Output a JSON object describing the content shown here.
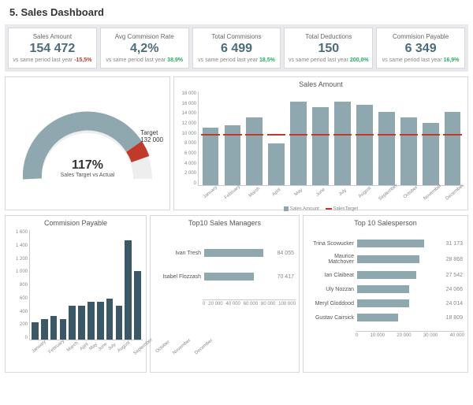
{
  "page_title": "5. Sales Dashboard",
  "kpis": [
    {
      "title": "Sales Amount",
      "value": "154 472",
      "sub": "vs same period last year",
      "pct": "-15,5%",
      "dir": "neg"
    },
    {
      "title": "Avg Commision Rate",
      "value": "4,2%",
      "sub": "vs same period last year",
      "pct": "38,9%",
      "dir": "pos"
    },
    {
      "title": "Total Commisions",
      "value": "6 499",
      "sub": "vs same period last year",
      "pct": "18,5%",
      "dir": "pos"
    },
    {
      "title": "Total Deductions",
      "value": "150",
      "sub": "vs same period last year",
      "pct": "200,0%",
      "dir": "pos"
    },
    {
      "title": "Commision Payable",
      "value": "6 349",
      "sub": "vs same period last year",
      "pct": "16,9%",
      "dir": "pos"
    }
  ],
  "gauge": {
    "target_label": "Target",
    "target_value": "132 000",
    "pct": "117%",
    "sub": "Sales Target vs Actual"
  },
  "sales_chart": {
    "title": "Sales Amount",
    "legend_a": "Sales Amount",
    "legend_b": "SalesTarget"
  },
  "commission_title": "Commision Payable",
  "managers_title": "Top10 Sales Managers",
  "salesperson_title": "Top 10 Salesperson",
  "chart_data": {
    "sales_amount": {
      "type": "bar",
      "title": "Sales Amount",
      "categories": [
        "January",
        "February",
        "March",
        "April",
        "May",
        "June",
        "July",
        "August",
        "September",
        "October",
        "November",
        "December"
      ],
      "series": [
        {
          "name": "Sales Amount",
          "values": [
            11000,
            11500,
            13000,
            8000,
            16000,
            15000,
            16000,
            15500,
            14000,
            13000,
            12000,
            14000
          ]
        },
        {
          "name": "SalesTarget",
          "values": [
            9500,
            9500,
            9500,
            9500,
            9500,
            9500,
            9500,
            9500,
            9500,
            9500,
            9500,
            9500
          ]
        }
      ],
      "ylim": [
        0,
        18000
      ],
      "yticks": [
        0,
        2000,
        4000,
        6000,
        8000,
        10000,
        12000,
        14000,
        16000,
        18000
      ]
    },
    "gauge": {
      "type": "gauge",
      "title": "Sales Target vs Actual",
      "value_pct": 117,
      "target": 132000
    },
    "commission_payable": {
      "type": "bar",
      "title": "Commision Payable",
      "categories": [
        "January",
        "February",
        "March",
        "April",
        "May",
        "June",
        "July",
        "August",
        "September",
        "October",
        "November",
        "December"
      ],
      "values": [
        250,
        300,
        350,
        300,
        500,
        500,
        550,
        550,
        600,
        500,
        1450,
        1000
      ],
      "ylim": [
        0,
        1600
      ],
      "yticks": [
        0,
        200,
        400,
        600,
        800,
        1000,
        1200,
        1400,
        1600
      ]
    },
    "top_managers": {
      "type": "bar_h",
      "title": "Top10 Sales Managers",
      "categories": [
        "Ivan Tresh",
        "Isabel Flozzash"
      ],
      "values": [
        84055,
        70417
      ],
      "xlim": [
        0,
        100000
      ],
      "xticks": [
        0,
        20000,
        40000,
        60000,
        80000,
        100000
      ]
    },
    "top_salesperson": {
      "type": "bar_h",
      "title": "Top 10 Salesperson",
      "categories": [
        "Trina Scowucker",
        "Maurice Matchover",
        "Ian Claibeat",
        "Uly Nozzan",
        "Meryl Gloddood",
        "Gustav Cairsick"
      ],
      "values": [
        31173,
        28868,
        27542,
        24066,
        24014,
        18809
      ],
      "xlim": [
        0,
        40000
      ],
      "xticks": [
        0,
        10000,
        20000,
        30000,
        40000
      ]
    }
  }
}
